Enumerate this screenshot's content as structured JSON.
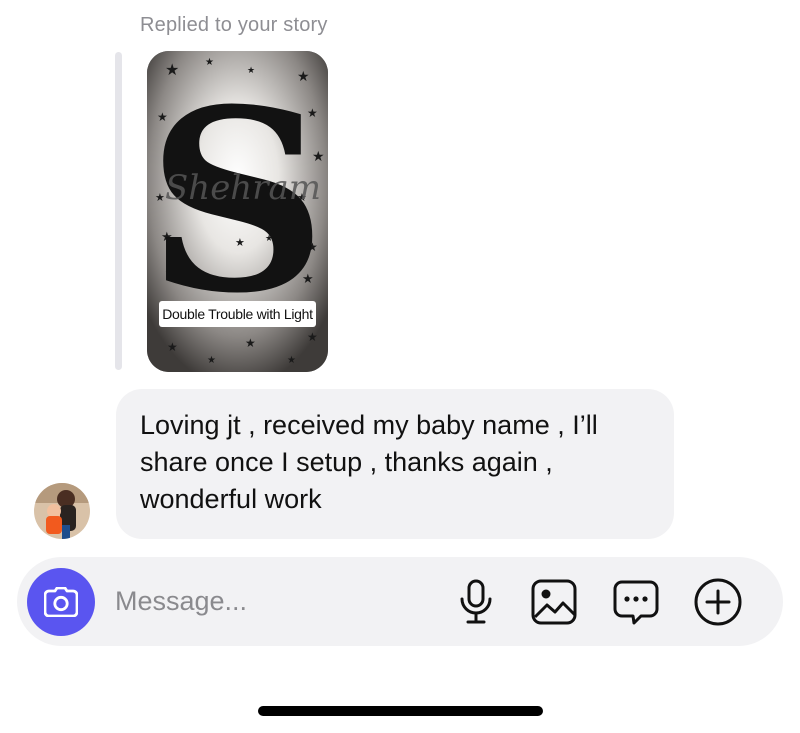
{
  "reply": {
    "label": "Replied to your story"
  },
  "story": {
    "caption": "Double Trouble with Light",
    "letter": "S",
    "name_overlay": "Shehram"
  },
  "message": {
    "text": "Loving jt , received my baby name , I’ll share once I setup , thanks again , wonderful work"
  },
  "composer": {
    "placeholder": "Message...",
    "icons": [
      "camera-icon",
      "microphone-icon",
      "gallery-icon",
      "sticker-chat-icon",
      "plus-icon"
    ]
  },
  "colors": {
    "camera_button": "#5a55f0",
    "bubble": "#f2f2f4",
    "muted_text": "#8e8e93"
  }
}
